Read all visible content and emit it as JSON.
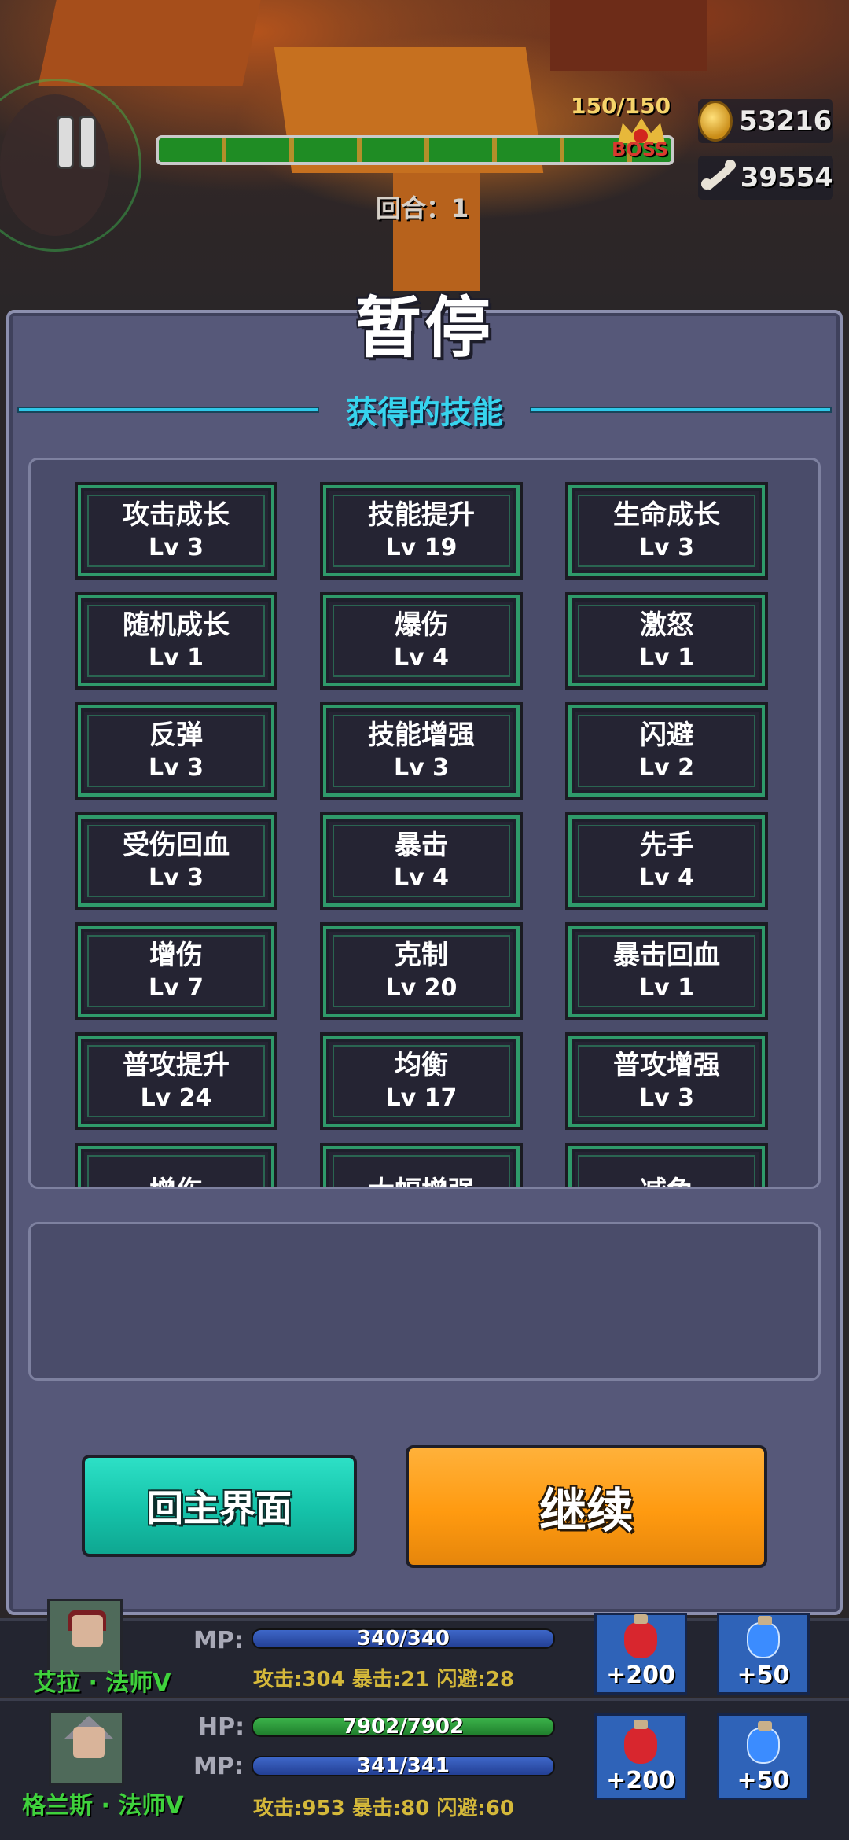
{
  "hud": {
    "boss_hp": "150/150",
    "boss_label": "BOSS",
    "round": "回合：1",
    "gold": "53216",
    "bones": "39554"
  },
  "panel": {
    "title": "暂停",
    "section_title": "获得的技能"
  },
  "skills": [
    {
      "name": "攻击成长",
      "level": "Lv 3"
    },
    {
      "name": "技能提升",
      "level": "Lv 19"
    },
    {
      "name": "生命成长",
      "level": "Lv 3"
    },
    {
      "name": "随机成长",
      "level": "Lv 1"
    },
    {
      "name": "爆伤",
      "level": "Lv 4"
    },
    {
      "name": "激怒",
      "level": "Lv 1"
    },
    {
      "name": "反弹",
      "level": "Lv 3"
    },
    {
      "name": "技能增强",
      "level": "Lv 3"
    },
    {
      "name": "闪避",
      "level": "Lv 2"
    },
    {
      "name": "受伤回血",
      "level": "Lv 3"
    },
    {
      "name": "暴击",
      "level": "Lv 4"
    },
    {
      "name": "先手",
      "level": "Lv 4"
    },
    {
      "name": "增伤",
      "level": "Lv 7"
    },
    {
      "name": "克制",
      "level": "Lv 20"
    },
    {
      "name": "暴击回血",
      "level": "Lv 1"
    },
    {
      "name": "普攻提升",
      "level": "Lv 24"
    },
    {
      "name": "均衡",
      "level": "Lv 17"
    },
    {
      "name": "普攻增强",
      "level": "Lv 3"
    },
    {
      "name": "增伤",
      "level": ""
    },
    {
      "name": "大幅增强",
      "level": ""
    },
    {
      "name": "减免",
      "level": ""
    }
  ],
  "buttons": {
    "home": "回主界面",
    "continue": "继续"
  },
  "heroes": [
    {
      "name": "艾拉 · 法师Ⅴ",
      "mp_label": "MP:",
      "mp": "340/340",
      "stats": "攻击:304  暴击:21  闪避:28",
      "hp_potion": "+200",
      "mp_potion": "+50"
    },
    {
      "name": "格兰斯 · 法师Ⅴ",
      "hp_label": "HP:",
      "hp": "7902/7902",
      "mp_label": "MP:",
      "mp": "341/341",
      "stats": "攻击:953  暴击:80  闪避:60",
      "hp_potion": "+200",
      "mp_potion": "+50"
    }
  ],
  "colors": {
    "panel": "#565879",
    "accent_cyan": "#36d4ee",
    "home_button": "#15c2a9",
    "continue_button": "#ff9a10"
  }
}
